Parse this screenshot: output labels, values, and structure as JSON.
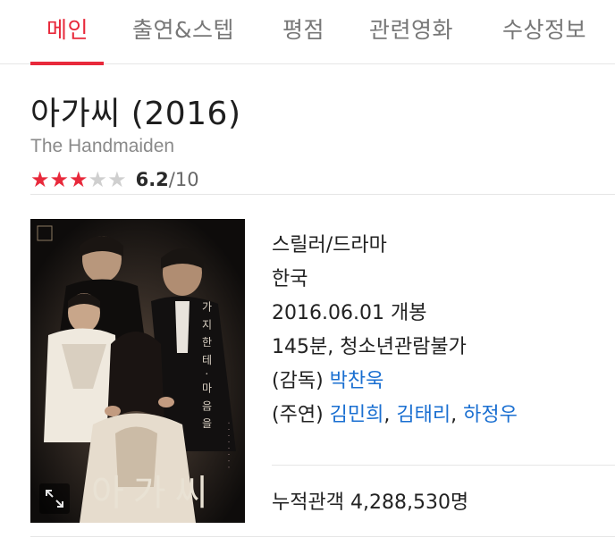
{
  "tabs": [
    {
      "label": "메인",
      "active": true
    },
    {
      "label": "출연&스텝",
      "active": false
    },
    {
      "label": "평점",
      "active": false
    },
    {
      "label": "관련영화",
      "active": false
    },
    {
      "label": "수상정보",
      "active": false
    }
  ],
  "movie": {
    "title": "아가씨 (2016)",
    "original_title": "The Handmaiden",
    "rating": {
      "stars_filled": 3,
      "stars_total": 5,
      "score": "6.2",
      "max": "/10"
    },
    "poster": {
      "title_text": "아가씨",
      "zoom_icon": "expand-icon"
    },
    "genre": "스릴러/드라마",
    "country": "한국",
    "release": "2016.06.01 개봉",
    "runtime_rating": "145분, 청소년관람불가",
    "director": {
      "label": "(감독)",
      "name": "박찬욱"
    },
    "cast": {
      "label": "(주연)",
      "names": [
        "김민희",
        "김태리",
        "하정우"
      ],
      "separator": ","
    },
    "audience": {
      "label": "누적관객",
      "value": "4,288,530명"
    }
  },
  "colors": {
    "accent": "#e8293b",
    "link": "#1a6fd1"
  }
}
